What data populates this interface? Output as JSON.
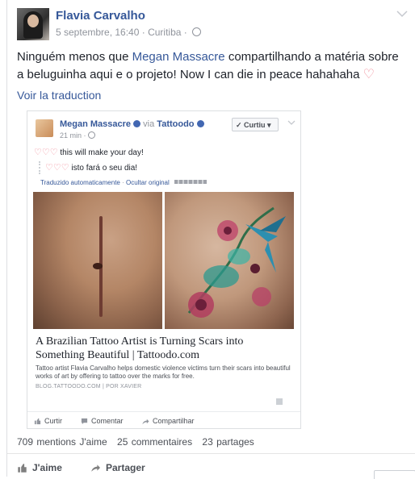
{
  "post": {
    "author": "Flavia Carvalho",
    "date": "5 septembre, 16:40",
    "separator": "·",
    "location": "Curitiba",
    "text_before": "Ninguém menos que ",
    "mention": "Megan Massacre",
    "text_after": " compartilhando a matéria sobre a beluguinha aqui e o projeto! Now I can die in peace hahahaha ",
    "heart": "♡",
    "translate_link": "Voir la traduction"
  },
  "shared": {
    "author": "Megan Massacre",
    "via": "via",
    "page": "Tattoodo",
    "time": "21 min",
    "liked_button": "Curtiu",
    "hearts": "♡♡♡",
    "text": "this will make your day!",
    "translated": "isto fará o seu dia!",
    "auto_translated": "Traduzido automaticamente",
    "hide_original": "Ocultar original",
    "link_title": "A Brazilian Tattoo Artist is Turning Scars into Something Beautiful | Tattoodo.com",
    "link_desc": "Tattoo artist Flavia Carvalho helps domestic violence victims turn their scars into beautiful works of art by offering to tattoo over the marks for free.",
    "link_source": "BLOG.TATTOODO.COM",
    "link_by": "POR XAVIER",
    "actions": {
      "like": "Curtir",
      "comment": "Comentar",
      "share": "Compartilhar"
    }
  },
  "stats": {
    "likes": "709 mentions J'aime",
    "comments": "25 commentaires",
    "shares": "23 partages"
  },
  "actions": {
    "like": "J'aime",
    "share": "Partager"
  },
  "colors": {
    "link": "#365899",
    "meta": "#90949c",
    "text": "#1d2129",
    "heart": "#f08a98"
  }
}
